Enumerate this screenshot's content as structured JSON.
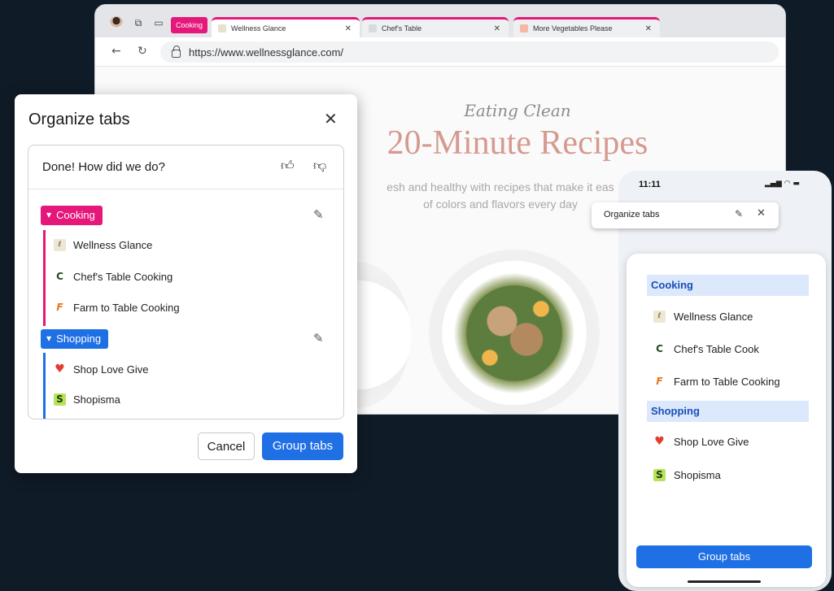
{
  "browser": {
    "group_chip": "Cooking",
    "tabs": [
      {
        "title": "Wellness Glance",
        "close": "✕"
      },
      {
        "title": "Chef's Table",
        "close": "✕"
      },
      {
        "title": "More Vegetables Please",
        "close": "✕"
      }
    ],
    "url": "https://www.wellnessglance.com/",
    "page": {
      "eyebrow": "Eating Clean",
      "title": "20-Minute Recipes",
      "subtitle_line1": "esh and healthy with recipes that make it eas",
      "subtitle_line2": "of colors and flavors every day"
    }
  },
  "dialog": {
    "title": "Organize tabs",
    "feedback": "Done! How did we do?",
    "groups": [
      {
        "name": "Cooking",
        "color": "#e5177b",
        "tabs": [
          "Wellness Glance",
          "Chef's Table Cooking",
          "Farm to Table Cooking"
        ]
      },
      {
        "name": "Shopping",
        "color": "#1f6fe5",
        "tabs": [
          "Shop Love Give",
          "Shopisma"
        ]
      }
    ],
    "cancel": "Cancel",
    "primary": "Group tabs"
  },
  "mobile": {
    "time": "11:11",
    "header_title": "Organize tabs",
    "groups": [
      {
        "name": "Cooking",
        "tabs": [
          "Wellness Glance",
          "Chef's Table Cook",
          "Farm to Table Cooking"
        ]
      },
      {
        "name": "Shopping",
        "tabs": [
          "Shop Love Give",
          "Shopisma"
        ]
      }
    ],
    "button": "Group tabs"
  },
  "icons": {
    "wellness": "🌿",
    "chef": "C",
    "farm": "F",
    "shop": "♥",
    "shopisma": "S"
  }
}
